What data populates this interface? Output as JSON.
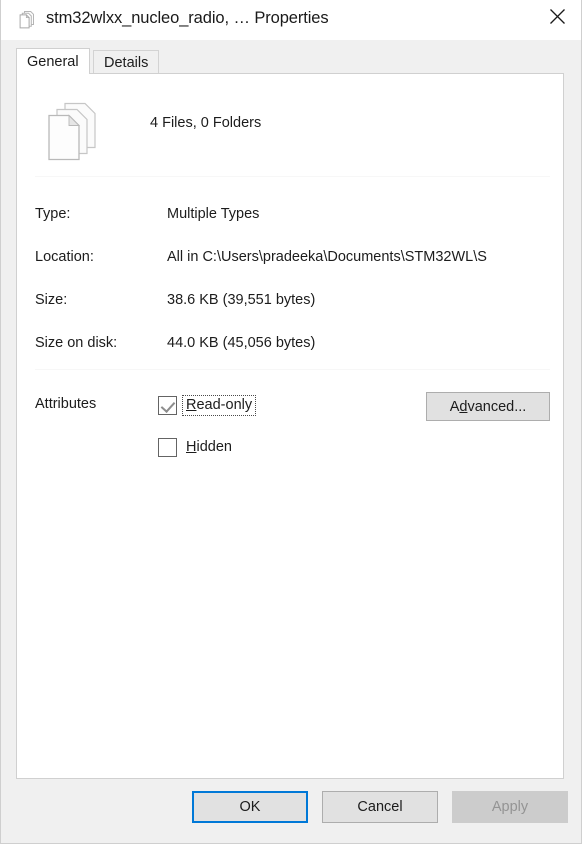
{
  "window": {
    "title": "stm32wlxx_nucleo_radio, … Properties",
    "icon": "multiple-files-icon",
    "close_label": "Close"
  },
  "tabs": [
    {
      "label": "General",
      "active": true
    },
    {
      "label": "Details",
      "active": false
    }
  ],
  "general": {
    "file_icon": "file-stack-icon",
    "summary": "4 Files, 0 Folders",
    "rows": [
      {
        "label": "Type:",
        "value": "Multiple Types"
      },
      {
        "label": "Location:",
        "value": "All in C:\\Users\\pradeeka\\Documents\\STM32WL\\S"
      },
      {
        "label": "Size:",
        "value": "38.6 KB (39,551 bytes)"
      },
      {
        "label": "Size on disk:",
        "value": "44.0 KB (45,056 bytes)"
      }
    ],
    "attributes": {
      "label": "Attributes",
      "readonly": {
        "label_before": "R",
        "label_after": "ead-only",
        "checked": true,
        "focused": true
      },
      "hidden": {
        "label_before": "H",
        "label_after": "idden",
        "checked": false,
        "focused": false
      },
      "advanced_before": "A",
      "advanced_accel": "d",
      "advanced_after": "vanced..."
    }
  },
  "footer": {
    "ok_label": "OK",
    "cancel_label": "Cancel",
    "apply_label": "Apply",
    "apply_disabled": true
  },
  "colors": {
    "accent": "#0078d7",
    "window_bg": "#f0f0f0",
    "panel_bg": "#ffffff",
    "text": "#1c1c1c",
    "disabled_text": "#949494"
  }
}
